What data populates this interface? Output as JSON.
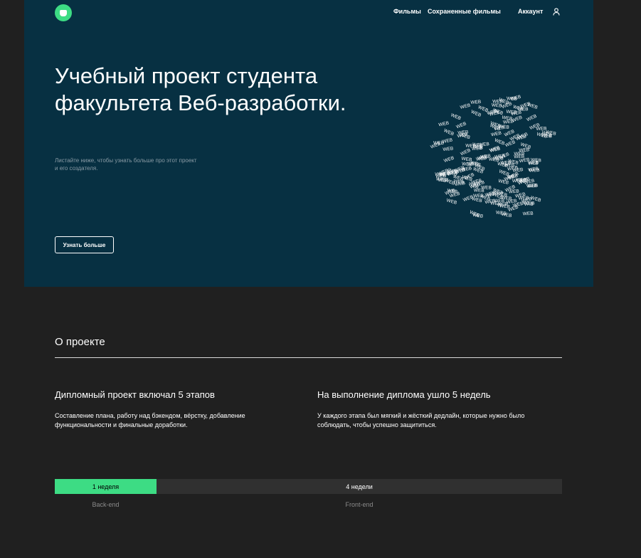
{
  "colors": {
    "accent": "#3ddc84",
    "hero_background": "#073042",
    "page_background": "#202020"
  },
  "header": {
    "logo_icon": "logo-icon",
    "nav": {
      "movies": "Фильмы",
      "saved_movies": "Сохраненные фильмы"
    },
    "account": {
      "label": "Аккаунт",
      "icon": "user-icon"
    }
  },
  "hero": {
    "title": "Учебный проект студента факультета Веб-разработки.",
    "subtitle": "Листайте ниже, чтобы узнать больше про этот проект и его создателя.",
    "button_label": "Узнать больше",
    "globe_word": "WEB"
  },
  "about": {
    "title": "О проекте",
    "items": [
      {
        "title": "Дипломный проект включал 5 этапов",
        "text": "Составление плана, работу над бэкендом, вёрстку, добавление функциональности и финальные доработки."
      },
      {
        "title": "На выполнение диплома ушло 5 недель",
        "text": "У каждого этапа был мягкий и жёсткий дедлайн, которые нужно было соблюдать, чтобы успешно защититься."
      }
    ],
    "timeline": {
      "backend_duration": "1 неделя",
      "frontend_duration": "4 недели",
      "backend_label": "Back-end",
      "frontend_label": "Front-end"
    }
  }
}
